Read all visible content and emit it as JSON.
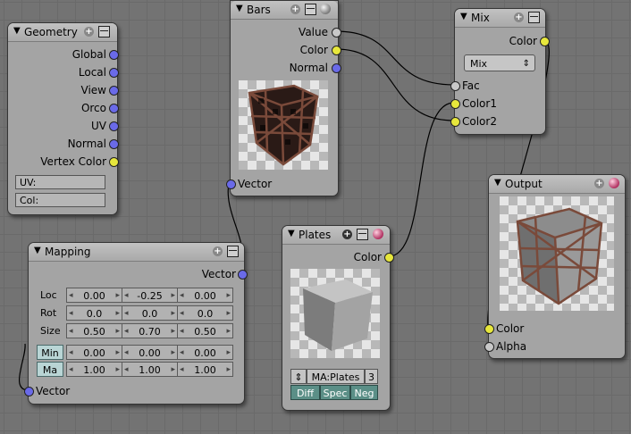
{
  "nodes": {
    "geometry": {
      "title": "Geometry",
      "outputs": [
        "Global",
        "Local",
        "View",
        "Orco",
        "UV",
        "Normal",
        "Vertex Color"
      ],
      "fields": [
        "UV:",
        "Col:"
      ]
    },
    "bars": {
      "title": "Bars",
      "outputs": [
        "Value",
        "Color",
        "Normal"
      ],
      "input": "Vector"
    },
    "mix": {
      "title": "Mix",
      "output": "Color",
      "blend_mode": "Mix",
      "inputs": [
        "Fac",
        "Color1",
        "Color2"
      ]
    },
    "output": {
      "title": "Output",
      "inputs": [
        "Color",
        "Alpha"
      ]
    },
    "mapping": {
      "title": "Mapping",
      "output": "Vector",
      "rows": [
        {
          "label": "Loc",
          "values": [
            "0.00",
            "-0.25",
            "0.00"
          ]
        },
        {
          "label": "Rot",
          "values": [
            "0.0",
            "0.0",
            "0.0"
          ]
        },
        {
          "label": "Size",
          "values": [
            "0.50",
            "0.70",
            "0.50"
          ]
        }
      ],
      "min": {
        "label": "Min",
        "values": [
          "0.00",
          "0.00",
          "0.00"
        ]
      },
      "max": {
        "label": "Ma",
        "values": [
          "1.00",
          "1.00",
          "1.00"
        ]
      },
      "input": "Vector"
    },
    "plates": {
      "title": "Plates",
      "output": "Color",
      "material_name": "MA:Plates",
      "user_count": "3",
      "toggles": [
        "Diff",
        "Spec",
        "Neg"
      ]
    }
  },
  "colors": {
    "vector_socket": "#6a6ae8",
    "color_socket": "#e7e73c",
    "value_socket": "#c8c8c8"
  }
}
